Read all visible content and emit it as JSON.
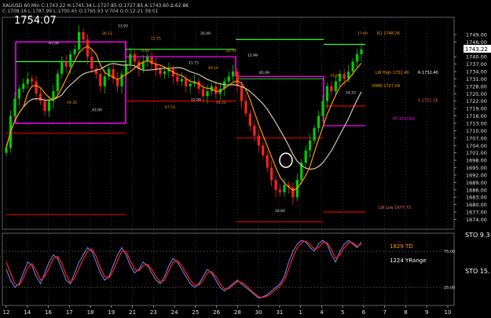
{
  "header": {
    "ohlc_line": "XAUUSD 60 Min  C:1743.22  H:1745.34  L:1727.85  O:1727.85  A:1743.60  Δ:62.8K",
    "study_line": "C:1708.16  L:1787.99  L:1700.45  O:1765.93  V:704  G:0:12:21  39:01",
    "big_price": "1754.07"
  },
  "colors": {
    "up_candle": "#00cc00",
    "down_candle": "#ff2020",
    "ma_orange": "#ff9900",
    "ma_tan": "#d8c8a8",
    "magenta": "#ff00ff",
    "green_line": "#33ff33",
    "red_line": "#e00000",
    "stoch_red": "#ff2020",
    "stoch_blue": "#6f8cff"
  },
  "chart_data": [
    {
      "type": "candlestick",
      "title": "",
      "price_axis_ticks": [
        1749.0,
        1746.0,
        1740.0,
        1737.0,
        1734.0,
        1731.0,
        1728.0,
        1725.0,
        1722.0,
        1719.0,
        1716.0,
        1713.0,
        1710.0,
        1707.0,
        1704.0,
        1701.0,
        1698.0,
        1695.0,
        1692.0,
        1689.0,
        1686.0,
        1683.0,
        1680.0,
        1677.0,
        1674.0
      ],
      "ylim": [
        1670,
        1756
      ],
      "current_price": 1743.22,
      "x_tick_labels": [
        "12",
        "14",
        "16",
        "17",
        "18",
        "19",
        "21",
        "23",
        "24",
        "25",
        "26",
        "28",
        "30",
        "31",
        "1",
        "4",
        "5",
        "6",
        "7",
        "8",
        "9",
        "10"
      ],
      "level_labels": {
        "r1": "R1 1748.26",
        "lw_high": "LW High 1732.40",
        "r_right": "R 1732.40",
        "rmw": "RMW 1727.04",
        "lw_high_mid": "S 1721.16",
        "pp": "PP 1713.62",
        "lw_low": "LW Low 1677.73"
      },
      "swing_labels": [
        "47.00",
        "26.12",
        "13.93",
        "15.75",
        "20.49",
        "25.51",
        "12.99",
        "19.30",
        "43.00",
        "67.53",
        "12.99",
        "14.22",
        "16.60",
        "19.24",
        "14.33",
        "17.69",
        "85.09",
        "9.40",
        "11.73",
        "49.16"
      ],
      "closes": [
        1703,
        1716,
        1723,
        1727,
        1729,
        1731,
        1730,
        1725,
        1722,
        1718,
        1722,
        1726,
        1733,
        1738,
        1736,
        1741,
        1743,
        1750,
        1747,
        1740,
        1735,
        1733,
        1728,
        1732,
        1735,
        1731,
        1728,
        1733,
        1737,
        1741,
        1738,
        1735,
        1738,
        1740,
        1737,
        1735,
        1733,
        1734,
        1735,
        1732,
        1730,
        1731,
        1728,
        1729,
        1730,
        1727,
        1724,
        1726,
        1728,
        1725,
        1727,
        1730,
        1732,
        1734,
        1728,
        1722,
        1717,
        1712,
        1708,
        1704,
        1700,
        1695,
        1690,
        1686,
        1685,
        1688,
        1687,
        1683,
        1690,
        1697,
        1702,
        1706,
        1711,
        1716,
        1722,
        1728,
        1726,
        1730,
        1733,
        1731,
        1734,
        1738,
        1741,
        1743
      ]
    },
    {
      "type": "line",
      "title": "",
      "series": [
        {
          "name": "",
          "values": [
            50,
            35,
            25,
            30,
            45,
            60,
            55,
            40,
            30,
            45,
            60,
            70,
            65,
            50,
            35,
            30,
            45,
            60,
            70,
            80,
            75,
            60,
            45,
            35,
            40,
            55,
            70,
            80,
            70,
            55,
            45,
            50,
            60,
            55,
            45,
            35,
            30,
            40,
            55,
            65,
            60,
            50,
            40,
            30,
            25,
            30,
            40,
            50,
            45,
            35,
            25,
            20,
            25,
            30,
            35,
            30,
            25,
            20,
            15,
            10,
            12,
            15,
            20,
            25,
            30,
            40,
            60,
            75,
            85,
            90,
            88,
            80,
            75,
            85,
            90,
            85,
            70,
            60,
            75,
            85,
            90,
            85,
            80,
            88
          ]
        },
        {
          "name": "",
          "values": [
            60,
            45,
            30,
            28,
            38,
            52,
            58,
            48,
            35,
            40,
            52,
            65,
            68,
            58,
            42,
            32,
            38,
            52,
            64,
            75,
            78,
            68,
            52,
            40,
            38,
            48,
            62,
            75,
            75,
            62,
            50,
            48,
            55,
            57,
            50,
            40,
            32,
            35,
            48,
            60,
            62,
            55,
            45,
            35,
            28,
            28,
            35,
            45,
            47,
            40,
            30,
            23,
            23,
            28,
            33,
            32,
            28,
            22,
            17,
            12,
            11,
            13,
            17,
            22,
            27,
            35,
            50,
            67,
            80,
            87,
            89,
            84,
            78,
            80,
            87,
            87,
            77,
            65,
            70,
            80,
            87,
            87,
            82,
            85
          ]
        }
      ],
      "ylim": [
        0,
        100
      ],
      "ticks": [
        "75.00",
        "25.00"
      ],
      "label_td": "1829 TD",
      "label_range": "1224 YRange",
      "panel_label_top": "STO 9.3",
      "panel_label_mid": "STO 15."
    }
  ]
}
